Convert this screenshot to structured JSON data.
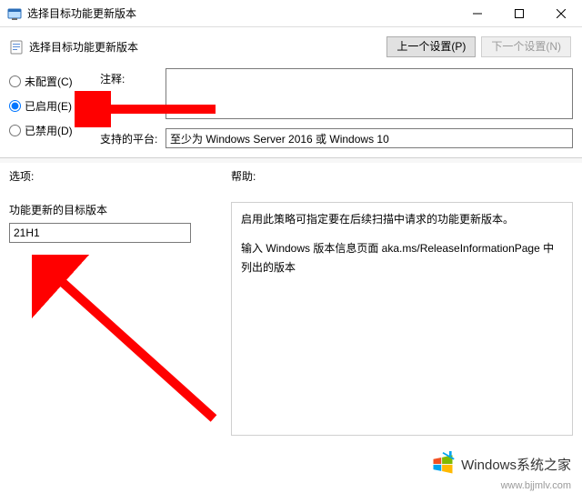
{
  "window": {
    "title": "选择目标功能更新版本"
  },
  "header": {
    "title": "选择目标功能更新版本",
    "prev_label": "上一个设置(P)",
    "next_label": "下一个设置(N)"
  },
  "config": {
    "radios": {
      "not_configured": "未配置(C)",
      "enabled": "已启用(E)",
      "disabled": "已禁用(D)"
    },
    "selected_radio": "enabled",
    "comment_label": "注释:",
    "comment_value": "",
    "platform_label": "支持的平台:",
    "platform_value": "至少为 Windows Server 2016 或 Windows 10"
  },
  "lower": {
    "options_title": "选项:",
    "help_title": "帮助:",
    "option_field_label": "功能更新的目标版本",
    "option_field_value": "21H1",
    "help_paragraph_1": "启用此策略可指定要在后续扫描中请求的功能更新版本。",
    "help_paragraph_2": "输入 Windows 版本信息页面 aka.ms/ReleaseInformationPage 中列出的版本"
  },
  "watermark": {
    "brand": "Windows系统之家",
    "url": "www.bjjmlv.com"
  }
}
